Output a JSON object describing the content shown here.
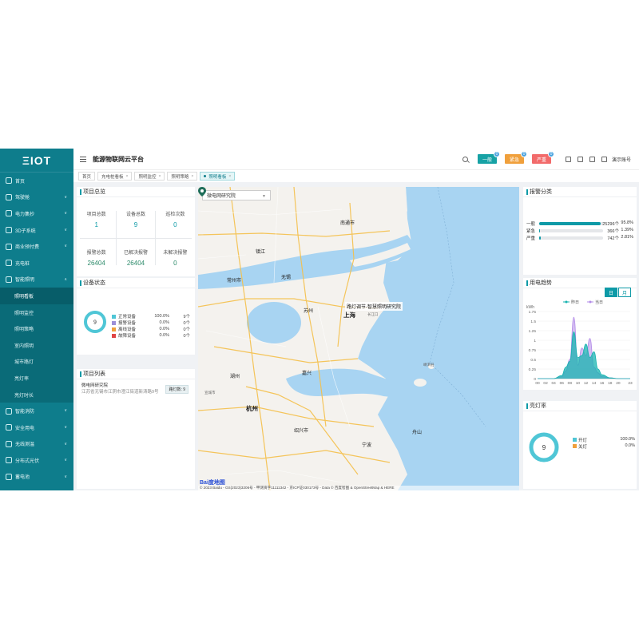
{
  "logo": "ΞIOT",
  "app_title": "能源物联网云平台",
  "sidebar": {
    "items": [
      {
        "label": "首页",
        "has_children": false
      },
      {
        "label": "驾驶舱",
        "has_children": true
      },
      {
        "label": "电力集抄",
        "has_children": true
      },
      {
        "label": "3D子系统",
        "has_children": true
      },
      {
        "label": "商业预付费",
        "has_children": true
      },
      {
        "label": "充电桩",
        "has_children": false
      },
      {
        "label": "智能照明",
        "has_children": true,
        "expanded": true
      }
    ],
    "subitems": [
      {
        "label": "照明看板",
        "active": true
      },
      {
        "label": "照明监控",
        "active": false
      },
      {
        "label": "照明策略",
        "active": false
      },
      {
        "label": "室内照明",
        "active": false
      },
      {
        "label": "城市路灯",
        "active": false
      },
      {
        "label": "亮灯率",
        "active": false
      },
      {
        "label": "亮灯时长",
        "active": false
      }
    ],
    "items_after": [
      {
        "label": "智能消防",
        "has_children": true
      },
      {
        "label": "安全用电",
        "has_children": true
      },
      {
        "label": "无线测温",
        "has_children": true
      },
      {
        "label": "分布式光伏",
        "has_children": true
      },
      {
        "label": "蓄电池",
        "has_children": true
      }
    ]
  },
  "header": {
    "alarms": [
      {
        "label": "一般",
        "count": "0",
        "color": "#17a2a5"
      },
      {
        "label": "紧急",
        "count": "0",
        "color": "#f0a03c"
      },
      {
        "label": "严重",
        "count": "0",
        "color": "#f26b6b"
      }
    ],
    "user": "演示账号"
  },
  "tabs": [
    {
      "label": "首页",
      "closable": false,
      "active": false
    },
    {
      "label": "充电桩看板",
      "closable": true,
      "active": false
    },
    {
      "label": "照明监控",
      "closable": true,
      "active": false
    },
    {
      "label": "照明策略",
      "closable": true,
      "active": false
    },
    {
      "label": "照明看板",
      "closable": true,
      "active": true
    }
  ],
  "overview": {
    "title": "项目总览",
    "stats": [
      {
        "label": "项目总数",
        "value": "1"
      },
      {
        "label": "设备总数",
        "value": "9"
      },
      {
        "label": "巡检次数",
        "value": "0"
      },
      {
        "label": "报警总数",
        "value": "26404"
      },
      {
        "label": "已解决报警",
        "value": "26404"
      },
      {
        "label": "未解决报警",
        "value": "0"
      }
    ]
  },
  "device_status": {
    "title": "设备状态",
    "total": "9",
    "rows": [
      {
        "name": "正常设备",
        "pct": "100.0%",
        "count": "9个",
        "color": "#4fc6d6"
      },
      {
        "name": "报警设备",
        "pct": "0.0%",
        "count": "0个",
        "color": "#9b8fd8"
      },
      {
        "name": "离线设备",
        "pct": "0.0%",
        "count": "0个",
        "color": "#f0a03c"
      },
      {
        "name": "故障设备",
        "pct": "0.0%",
        "count": "0个",
        "color": "#e04545"
      }
    ]
  },
  "project_list": {
    "title": "项目列表",
    "items": [
      {
        "name": "微电网研究院",
        "address": "江苏省无锡市江阴市澄江街道新涛路9号",
        "badge": "路灯数: 9"
      }
    ]
  },
  "map": {
    "selector": "微电网研究院",
    "marker_label": "路灯调节-智慧照明研究院",
    "logo": "Bai度地图",
    "credit": "© 2023 Baidu - GS(2023)3206号 - 甲测资字11111342 - 京ICP证030173号 - Data © 百度智图 & OpenStreetMap & HERE",
    "cities": [
      {
        "name": "上海",
        "big": true
      },
      {
        "name": "杭州",
        "big": false
      },
      {
        "name": "镇江",
        "big": false
      },
      {
        "name": "南通市",
        "big": false
      },
      {
        "name": "苏州",
        "big": false
      },
      {
        "name": "嘉兴",
        "big": false
      },
      {
        "name": "湖州",
        "big": false
      },
      {
        "name": "绍兴市",
        "big": false
      },
      {
        "name": "宁波",
        "big": false
      },
      {
        "name": "舟山",
        "big": false
      },
      {
        "name": "常州市",
        "big": false
      },
      {
        "name": "无锡",
        "big": false
      },
      {
        "name": "长江口",
        "big": false
      },
      {
        "name": "嵊泗县",
        "big": false
      },
      {
        "name": "宣城市",
        "big": false
      }
    ]
  },
  "alarm_category": {
    "title": "报警分类",
    "rows": [
      {
        "name": "一般",
        "count": "25296个",
        "pct": "95.8%",
        "fraction": 0.958
      },
      {
        "name": "紧急",
        "count": "366个",
        "pct": "1.39%",
        "fraction": 0.0139
      },
      {
        "name": "严重",
        "count": "742个",
        "pct": "2.81%",
        "fraction": 0.0281
      }
    ]
  },
  "trend": {
    "title": "用电趋势",
    "seg_day": "日",
    "seg_month": "月",
    "legend": [
      "昨日",
      "当日"
    ],
    "unit": "kWh"
  },
  "chart_data": {
    "type": "area",
    "ylabel": "kWh",
    "ylim": [
      0,
      1.75
    ],
    "yticks": [
      "1.75",
      "1.5",
      "1.25",
      "1",
      "0.75",
      "0.5",
      "0.25",
      "0"
    ],
    "xticks": [
      "00",
      "02",
      "04",
      "06",
      "08",
      "10",
      "12",
      "14",
      "16",
      "18",
      "20",
      "23"
    ],
    "x": [
      0,
      2,
      4,
      6,
      7,
      8,
      9,
      10,
      11,
      12,
      13,
      14,
      15,
      16,
      18,
      20,
      23
    ],
    "series": [
      {
        "name": "昨日",
        "color": "#17b3b0",
        "values": [
          0,
          0,
          0,
          0.08,
          0.3,
          0.45,
          1.22,
          0.55,
          0.6,
          0.9,
          0.55,
          0.7,
          0.25,
          0.1,
          0.02,
          0,
          0
        ]
      },
      {
        "name": "当日",
        "color": "#b28be8",
        "values": [
          0,
          0,
          0,
          0.05,
          0.2,
          0.5,
          1.6,
          0.35,
          0.8,
          0.6,
          1.05,
          0.3,
          0.15,
          0.05,
          0.02,
          0,
          0
        ]
      }
    ]
  },
  "light_rate": {
    "title": "亮灯率",
    "total": "9",
    "rows": [
      {
        "name": "开灯",
        "pct": "100.0%",
        "count": "9个",
        "color": "#4fc6d6"
      },
      {
        "name": "关灯",
        "pct": "0.0%",
        "count": "0个",
        "color": "#f0a03c"
      }
    ]
  },
  "colors": {
    "sidebar": "#0e7d8c",
    "accent": "#0e9aa7",
    "map_water": "#a8d4f2",
    "map_land": "#f4f2ee"
  }
}
